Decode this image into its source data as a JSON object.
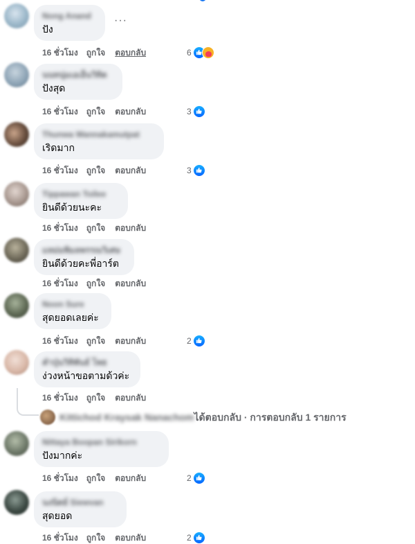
{
  "comments": [
    {
      "name": "Nong Anand",
      "text": "ปัง",
      "time": "16 ชั่วโมง",
      "like": "ถูกใจ",
      "reply": "ตอบกลับ",
      "count": "6",
      "reactions": [
        "like",
        "care"
      ],
      "avatar": "#9bb7c9"
    },
    {
      "name": "นนทนุ่มเอเอ็นวิทิต",
      "text": "ปังสุด",
      "time": "16 ชั่วโมง",
      "like": "ถูกใจ",
      "reply": "ตอบกลับ",
      "count": "3",
      "reactions": [
        "like"
      ],
      "avatar": "#8aa1b3"
    },
    {
      "name": "Thunwa Wannakamutpat",
      "text": "เริดมาก",
      "time": "16 ชั่วโมง",
      "like": "ถูกใจ",
      "reply": "ตอบกลับ",
      "count": "3",
      "reactions": [
        "like"
      ],
      "avatar": "#6a5040"
    },
    {
      "name": "Tippawan Toilee",
      "text": "ยินดีด้วยนะคะ",
      "time": "16 ชั่วโมง",
      "like": "ถูกใจ",
      "reply": "ตอบกลับ",
      "count": "",
      "reactions": [],
      "avatar": "#a89890"
    },
    {
      "name": "แหม่มพิมลพรรณวิเศษ",
      "text": "ยินดีด้วยคะพี่อาร์ต",
      "time": "16 ชั่วโมง",
      "like": "ถูกใจ",
      "reply": "ตอบกลับ",
      "count": "",
      "reactions": [],
      "avatar": "#6f6a5a"
    },
    {
      "name": "Noon Sure",
      "text": "สุดยอดเลยค่ะ",
      "time": "16 ชั่วโมง",
      "like": "ถูกใจ",
      "reply": "ตอบกลับ",
      "count": "2",
      "reactions": [
        "like"
      ],
      "avatar": "#5f6a55"
    },
    {
      "name": "คำปุ่นวิทิพันธ์ โพธ",
      "text": "ง่วงหน้าขอตามด้วค่ะ",
      "time": "16 ชั่วโมง",
      "like": "ถูกใจ",
      "reply": "ตอบกลับ",
      "count": "",
      "reactions": [],
      "avatar": "#d9b8a8"
    },
    {
      "name": "Nittaya Boopan Sirikorn",
      "text": "ปังมากค่ะ",
      "time": "16 ชั่วโมง",
      "like": "ถูกใจ",
      "reply": "ตอบกลับ",
      "count": "2",
      "reactions": [
        "like"
      ],
      "avatar": "#6f7a6a"
    },
    {
      "name": "นงนิตย์ Siewvan",
      "text": "สุดยอด",
      "time": "16 ชั่วโมง",
      "like": "ถูกใจ",
      "reply": "ตอบกลับ",
      "count": "2",
      "reactions": [
        "like"
      ],
      "avatar": "#3d4a44"
    }
  ],
  "reply_summary": {
    "name": "Kittichod Kraysak Nanachom",
    "text": "ได้ตอบกลับ · การตอบกลับ 1 รายการ"
  },
  "more_label": "···",
  "colors": {
    "like_blue": "#0866ff",
    "meta_gray": "#65676b",
    "bubble": "#f0f2f5"
  }
}
